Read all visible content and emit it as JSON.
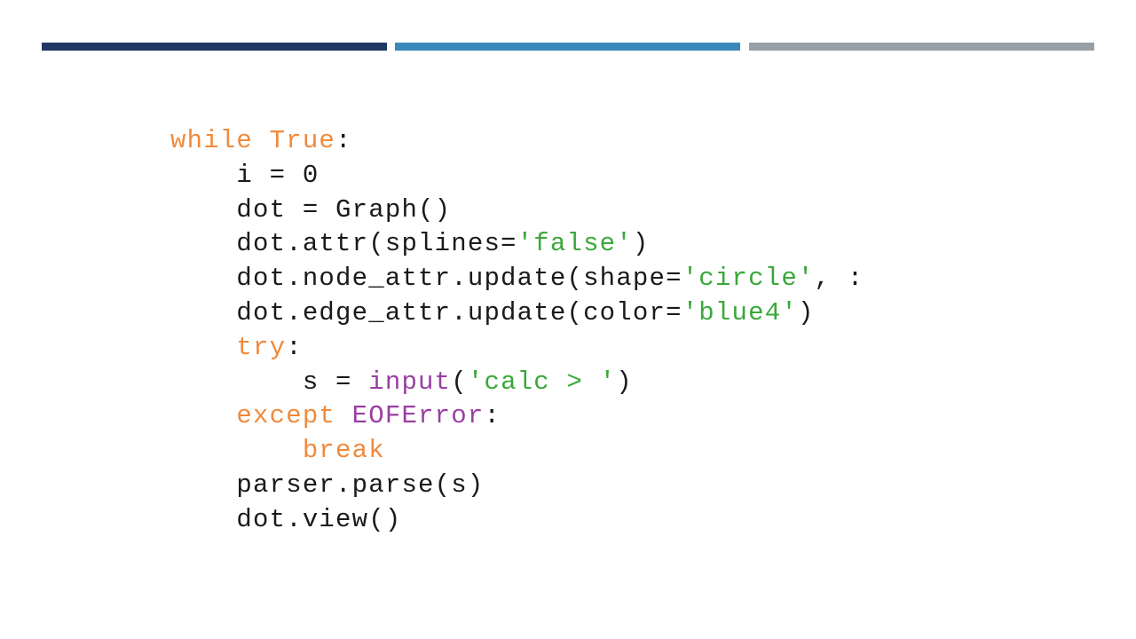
{
  "colors": {
    "bar_1": "#1f3864",
    "bar_2": "#3a87bc",
    "bar_3": "#97a0a8",
    "keyword": "#f08a3c",
    "string": "#3aa83a",
    "builtin": "#9a3fa2",
    "text": "#1a1a1a"
  },
  "code": {
    "language": "python",
    "lines": [
      [
        {
          "t": "while",
          "c": "kw"
        },
        {
          "t": " "
        },
        {
          "t": "True",
          "c": "kw"
        },
        {
          "t": ":"
        }
      ],
      [
        {
          "t": "    i = 0"
        }
      ],
      [
        {
          "t": "    dot = Graph()"
        }
      ],
      [
        {
          "t": "    dot.attr(splines="
        },
        {
          "t": "'false'",
          "c": "str"
        },
        {
          "t": ")"
        }
      ],
      [
        {
          "t": "    dot.node_attr.update(shape="
        },
        {
          "t": "'circle'",
          "c": "str"
        },
        {
          "t": ", :"
        }
      ],
      [
        {
          "t": "    dot.edge_attr.update(color="
        },
        {
          "t": "'blue4'",
          "c": "str"
        },
        {
          "t": ")"
        }
      ],
      [
        {
          "t": "    "
        },
        {
          "t": "try",
          "c": "kw"
        },
        {
          "t": ":"
        }
      ],
      [
        {
          "t": "        s = "
        },
        {
          "t": "input",
          "c": "fn"
        },
        {
          "t": "("
        },
        {
          "t": "'calc > '",
          "c": "str"
        },
        {
          "t": ")"
        }
      ],
      [
        {
          "t": "    "
        },
        {
          "t": "except",
          "c": "kw"
        },
        {
          "t": " "
        },
        {
          "t": "EOFError",
          "c": "fn"
        },
        {
          "t": ":"
        }
      ],
      [
        {
          "t": "        "
        },
        {
          "t": "break",
          "c": "kw"
        }
      ],
      [
        {
          "t": "    parser.parse(s)"
        }
      ],
      [
        {
          "t": "    dot.view()"
        }
      ]
    ]
  }
}
